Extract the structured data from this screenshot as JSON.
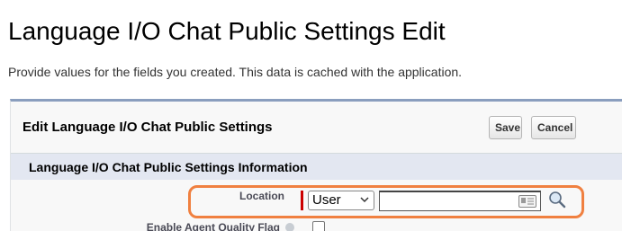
{
  "page": {
    "title": "Language I/O Chat Public Settings Edit",
    "description": "Provide values for the fields you created. This data is cached with the application."
  },
  "panel": {
    "title": "Edit Language I/O Chat Public Settings",
    "save_label": "Save",
    "cancel_label": "Cancel"
  },
  "section": {
    "title": "Language I/O Chat Public Settings Information"
  },
  "fields": {
    "location": {
      "label": "Location",
      "owner_type": "User",
      "lookup_value": ""
    },
    "agent_quality": {
      "label": "Enable Agent Quality Flag",
      "checked": false
    }
  },
  "colors": {
    "highlight": "#f08040",
    "required": "#cc0000",
    "section_bg": "#e3e7f1",
    "panel_border": "#8a9ebe"
  },
  "icons": {
    "chevron": "chevron-down-icon",
    "card": "card-icon",
    "lookup": "magnifier-icon",
    "help": "help-icon"
  }
}
